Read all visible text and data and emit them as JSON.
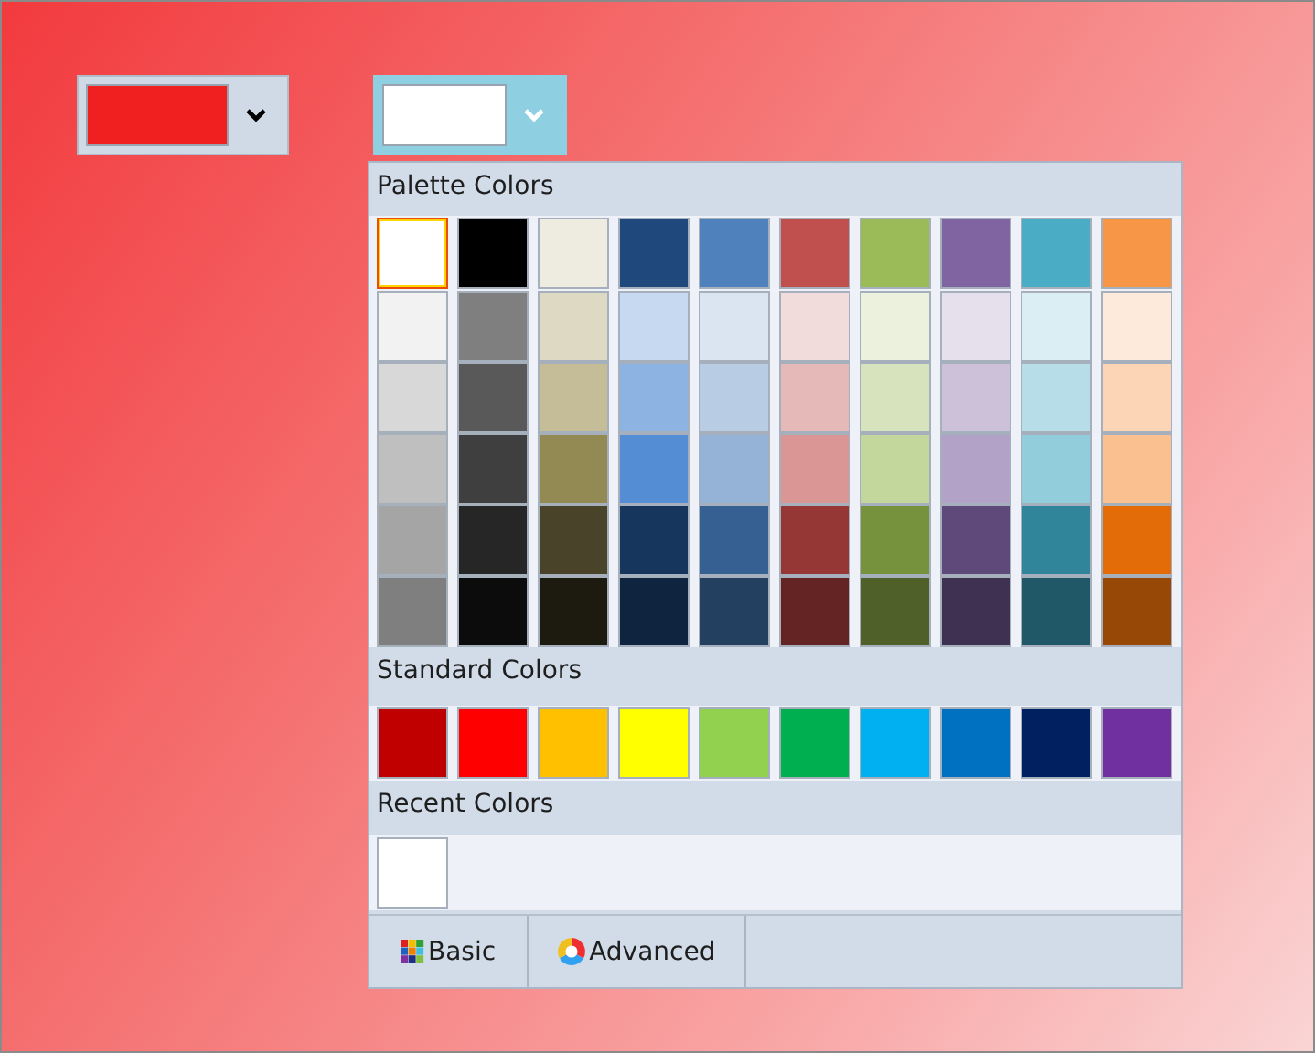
{
  "pickers": [
    {
      "color": "#f02020",
      "open": false
    },
    {
      "color": "#ffffff",
      "open": true
    }
  ],
  "palette": {
    "title": "Palette Colors",
    "rows": [
      [
        {
          "color": "#ffffff",
          "selected": true
        },
        {
          "color": "#000000",
          "selected": false
        },
        {
          "color": "#eeece1",
          "selected": false
        },
        {
          "color": "#1f497d",
          "selected": false
        },
        {
          "color": "#4f81bd",
          "selected": false
        },
        {
          "color": "#c0504d",
          "selected": false
        },
        {
          "color": "#9bbb59",
          "selected": false
        },
        {
          "color": "#8064a2",
          "selected": false
        },
        {
          "color": "#4bacc6",
          "selected": false
        },
        {
          "color": "#f79646",
          "selected": false
        }
      ],
      [
        {
          "color": "#f2f2f2",
          "selected": false
        },
        {
          "color": "#7f7f7f",
          "selected": false
        },
        {
          "color": "#ddd9c3",
          "selected": false
        },
        {
          "color": "#c6d9f0",
          "selected": false
        },
        {
          "color": "#dbe5f1",
          "selected": false
        },
        {
          "color": "#f2dcdb",
          "selected": false
        },
        {
          "color": "#ebf1dd",
          "selected": false
        },
        {
          "color": "#e5e0ec",
          "selected": false
        },
        {
          "color": "#dbeef3",
          "selected": false
        },
        {
          "color": "#fdeada",
          "selected": false
        }
      ],
      [
        {
          "color": "#d8d8d8",
          "selected": false
        },
        {
          "color": "#595959",
          "selected": false
        },
        {
          "color": "#c4bd97",
          "selected": false
        },
        {
          "color": "#8db3e2",
          "selected": false
        },
        {
          "color": "#b8cce4",
          "selected": false
        },
        {
          "color": "#e5b9b7",
          "selected": false
        },
        {
          "color": "#d7e3bc",
          "selected": false
        },
        {
          "color": "#ccc1d9",
          "selected": false
        },
        {
          "color": "#b7dde8",
          "selected": false
        },
        {
          "color": "#fbd5b5",
          "selected": false
        }
      ],
      [
        {
          "color": "#bfbfbf",
          "selected": false
        },
        {
          "color": "#3f3f3f",
          "selected": false
        },
        {
          "color": "#938953",
          "selected": false
        },
        {
          "color": "#548dd4",
          "selected": false
        },
        {
          "color": "#95b3d7",
          "selected": false
        },
        {
          "color": "#d99694",
          "selected": false
        },
        {
          "color": "#c3d69b",
          "selected": false
        },
        {
          "color": "#b2a2c7",
          "selected": false
        },
        {
          "color": "#92cddc",
          "selected": false
        },
        {
          "color": "#fac08f",
          "selected": false
        }
      ],
      [
        {
          "color": "#a5a5a5",
          "selected": false
        },
        {
          "color": "#262626",
          "selected": false
        },
        {
          "color": "#494429",
          "selected": false
        },
        {
          "color": "#17365d",
          "selected": false
        },
        {
          "color": "#366092",
          "selected": false
        },
        {
          "color": "#953734",
          "selected": false
        },
        {
          "color": "#76923c",
          "selected": false
        },
        {
          "color": "#5f497a",
          "selected": false
        },
        {
          "color": "#31859b",
          "selected": false
        },
        {
          "color": "#e36c09",
          "selected": false
        }
      ],
      [
        {
          "color": "#7f7f7f",
          "selected": false
        },
        {
          "color": "#0c0c0c",
          "selected": false
        },
        {
          "color": "#1d1b10",
          "selected": false
        },
        {
          "color": "#0f243e",
          "selected": false
        },
        {
          "color": "#244061",
          "selected": false
        },
        {
          "color": "#632423",
          "selected": false
        },
        {
          "color": "#4f6128",
          "selected": false
        },
        {
          "color": "#3f3151",
          "selected": false
        },
        {
          "color": "#205867",
          "selected": false
        },
        {
          "color": "#974806",
          "selected": false
        }
      ]
    ]
  },
  "standard": {
    "title": "Standard Colors",
    "swatches": [
      {
        "color": "#c00000",
        "selected": false
      },
      {
        "color": "#ff0000",
        "selected": false
      },
      {
        "color": "#ffc000",
        "selected": false
      },
      {
        "color": "#ffff00",
        "selected": false
      },
      {
        "color": "#92d050",
        "selected": false
      },
      {
        "color": "#00b050",
        "selected": false
      },
      {
        "color": "#00b0f0",
        "selected": false
      },
      {
        "color": "#0070c0",
        "selected": false
      },
      {
        "color": "#002060",
        "selected": false
      },
      {
        "color": "#7030a0",
        "selected": false
      }
    ]
  },
  "recent": {
    "title": "Recent Colors",
    "swatches": [
      {
        "color": "#ffffff",
        "selected": false
      }
    ]
  },
  "footer_buttons": [
    {
      "label": "Basic",
      "kind": "basic"
    },
    {
      "label": "Advanced",
      "kind": "advanced"
    }
  ]
}
